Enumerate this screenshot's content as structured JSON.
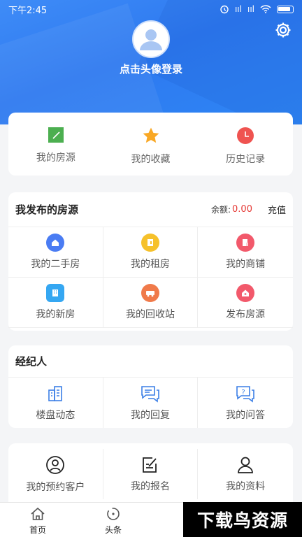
{
  "status_bar": {
    "time": "下午2:45",
    "signal1": "ııl",
    "signal2": "ııl"
  },
  "profile": {
    "login_prompt": "点击头像登录"
  },
  "quick_actions": [
    {
      "label": "我的房源",
      "icon": "edit-icon",
      "color": "#4caf50"
    },
    {
      "label": "我的收藏",
      "icon": "star-icon",
      "color": "#f9a825"
    },
    {
      "label": "历史记录",
      "icon": "clock-icon",
      "color": "#ef5350"
    }
  ],
  "listings": {
    "title": "我发布的房源",
    "balance_label": "余额:",
    "balance_value": "0.00",
    "recharge_label": "充值",
    "items": [
      {
        "label": "我的二手房",
        "icon": "home-icon",
        "color": "#4a7cf3"
      },
      {
        "label": "我的租房",
        "icon": "door-icon",
        "color": "#f6c12b"
      },
      {
        "label": "我的商铺",
        "icon": "shop-icon",
        "color": "#f2596b"
      },
      {
        "label": "我的新房",
        "icon": "building-icon",
        "color": "#35a7f2"
      },
      {
        "label": "我的回收站",
        "icon": "truck-icon",
        "color": "#f07a4a"
      },
      {
        "label": "发布房源",
        "icon": "publish-icon",
        "color": "#f2596b"
      }
    ]
  },
  "agent": {
    "title": "经纪人",
    "items": [
      {
        "label": "楼盘动态",
        "icon": "buildings-icon"
      },
      {
        "label": "我的回复",
        "icon": "reply-icon"
      },
      {
        "label": "我的问答",
        "icon": "qa-icon"
      }
    ]
  },
  "personal": {
    "items": [
      {
        "label": "我的预约客户",
        "icon": "customer-icon"
      },
      {
        "label": "我的报名",
        "icon": "signup-icon"
      },
      {
        "label": "我的资料",
        "icon": "profile-icon"
      }
    ]
  },
  "tabbar": [
    {
      "label": "首页",
      "icon": "home-outline-icon"
    },
    {
      "label": "头条",
      "icon": "headline-icon"
    }
  ],
  "watermark": "下载鸟资源",
  "accent_color": "#2f7df2"
}
